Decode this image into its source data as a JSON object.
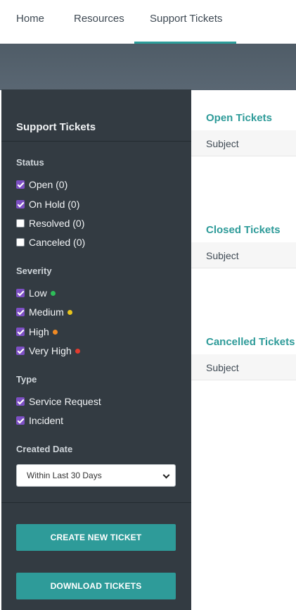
{
  "nav": {
    "home": "Home",
    "resources": "Resources",
    "support_tickets": "Support Tickets"
  },
  "sidebar": {
    "title": "Support Tickets",
    "status": {
      "label": "Status",
      "items": [
        {
          "label": "Open (0)",
          "checked": true
        },
        {
          "label": "On Hold (0)",
          "checked": true
        },
        {
          "label": "Resolved (0)",
          "checked": false
        },
        {
          "label": "Canceled (0)",
          "checked": false
        }
      ]
    },
    "severity": {
      "label": "Severity",
      "items": [
        {
          "label": "Low",
          "checked": true,
          "color": "#2ebd59"
        },
        {
          "label": "Medium",
          "checked": true,
          "color": "#e8c41c"
        },
        {
          "label": "High",
          "checked": true,
          "color": "#f08a24"
        },
        {
          "label": "Very High",
          "checked": true,
          "color": "#e23b2e"
        }
      ]
    },
    "type": {
      "label": "Type",
      "items": [
        {
          "label": "Service Request",
          "checked": true
        },
        {
          "label": "Incident",
          "checked": true
        }
      ]
    },
    "created_date": {
      "label": "Created Date",
      "selected": "Within Last 30 Days"
    },
    "create_button": "CREATE NEW TICKET",
    "download_button": "DOWNLOAD TICKETS"
  },
  "main": {
    "open": {
      "title": "Open Tickets",
      "column": "Subject"
    },
    "closed": {
      "title": "Closed Tickets",
      "column": "Subject"
    },
    "cancelled": {
      "title": "Cancelled Tickets",
      "column": "Subject"
    }
  },
  "colors": {
    "accent": "#2e9b99",
    "sidebar_bg": "#333b42",
    "checkbox": "#7d4fc4"
  }
}
